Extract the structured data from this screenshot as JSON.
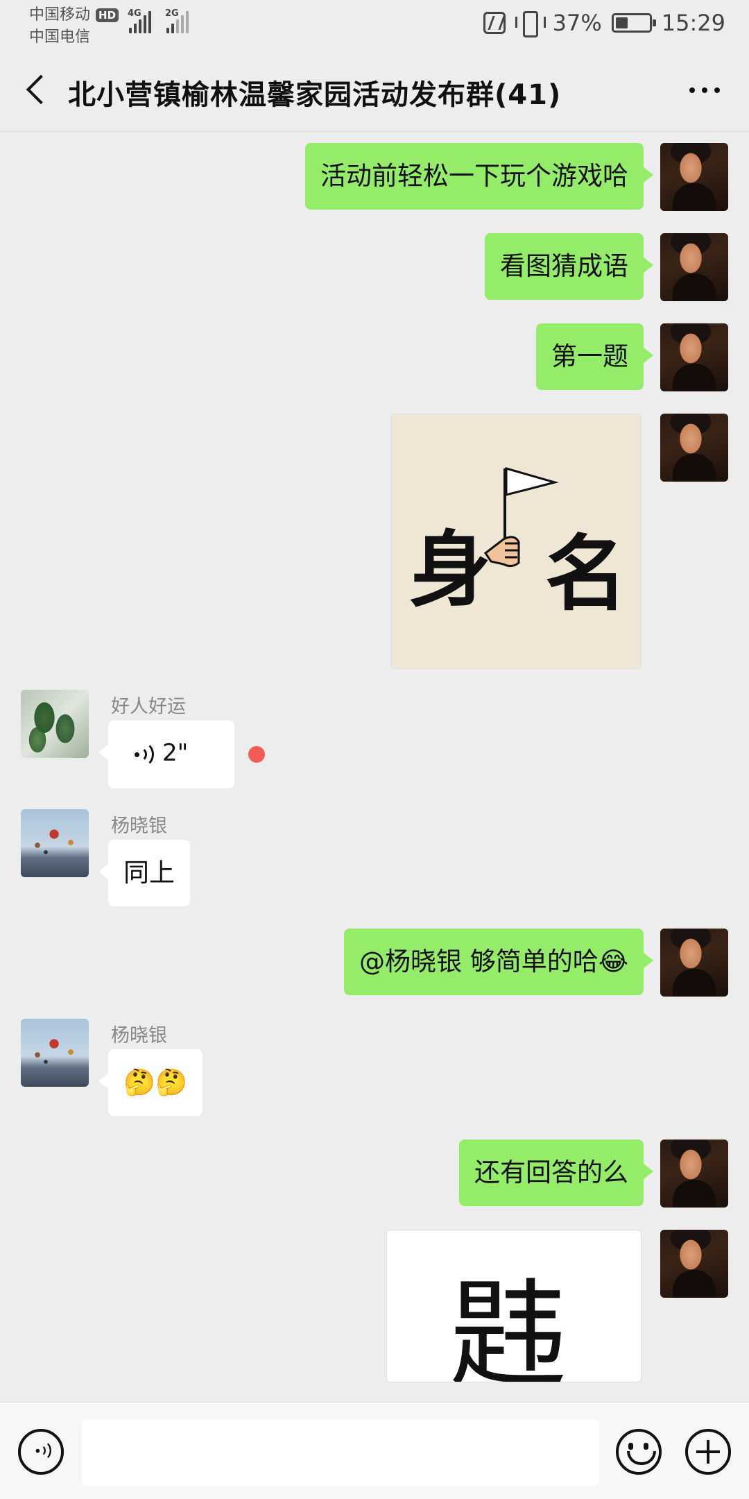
{
  "status_bar": {
    "carrier_1": "中国移动",
    "hd_badge": "HD",
    "carrier_2": "中国电信",
    "network_1": "4G",
    "network_2": "2G",
    "battery_percent": "37%",
    "time": "15:29"
  },
  "header": {
    "title": "北小营镇榆林温馨家园活动发布群(41)"
  },
  "messages": [
    {
      "sender": "self",
      "type": "text",
      "text": "活动前轻松一下玩个游戏哈"
    },
    {
      "sender": "self",
      "type": "text",
      "text": "看图猜成语"
    },
    {
      "sender": "self",
      "type": "text",
      "text": "第一题"
    },
    {
      "sender": "self",
      "type": "image",
      "characters": [
        "身",
        "名"
      ],
      "icon": "hand-holding-flag"
    },
    {
      "sender": "好人好运",
      "type": "voice",
      "duration": "2\"",
      "unread": true
    },
    {
      "sender": "杨晓银",
      "type": "text",
      "text": "同上"
    },
    {
      "sender": "self",
      "type": "text",
      "text": "@杨晓银  够简单的哈😂"
    },
    {
      "sender": "杨晓银",
      "type": "text",
      "text": "🤔🤔"
    },
    {
      "sender": "self",
      "type": "text",
      "text": "还有回答的么"
    },
    {
      "sender": "self",
      "type": "image",
      "characters": [
        "韪"
      ]
    }
  ],
  "input_bar": {
    "placeholder": ""
  },
  "colors": {
    "self_bubble": "#95ec69",
    "other_bubble": "#ffffff",
    "background": "#ededed",
    "unread_dot": "#f25c54"
  }
}
